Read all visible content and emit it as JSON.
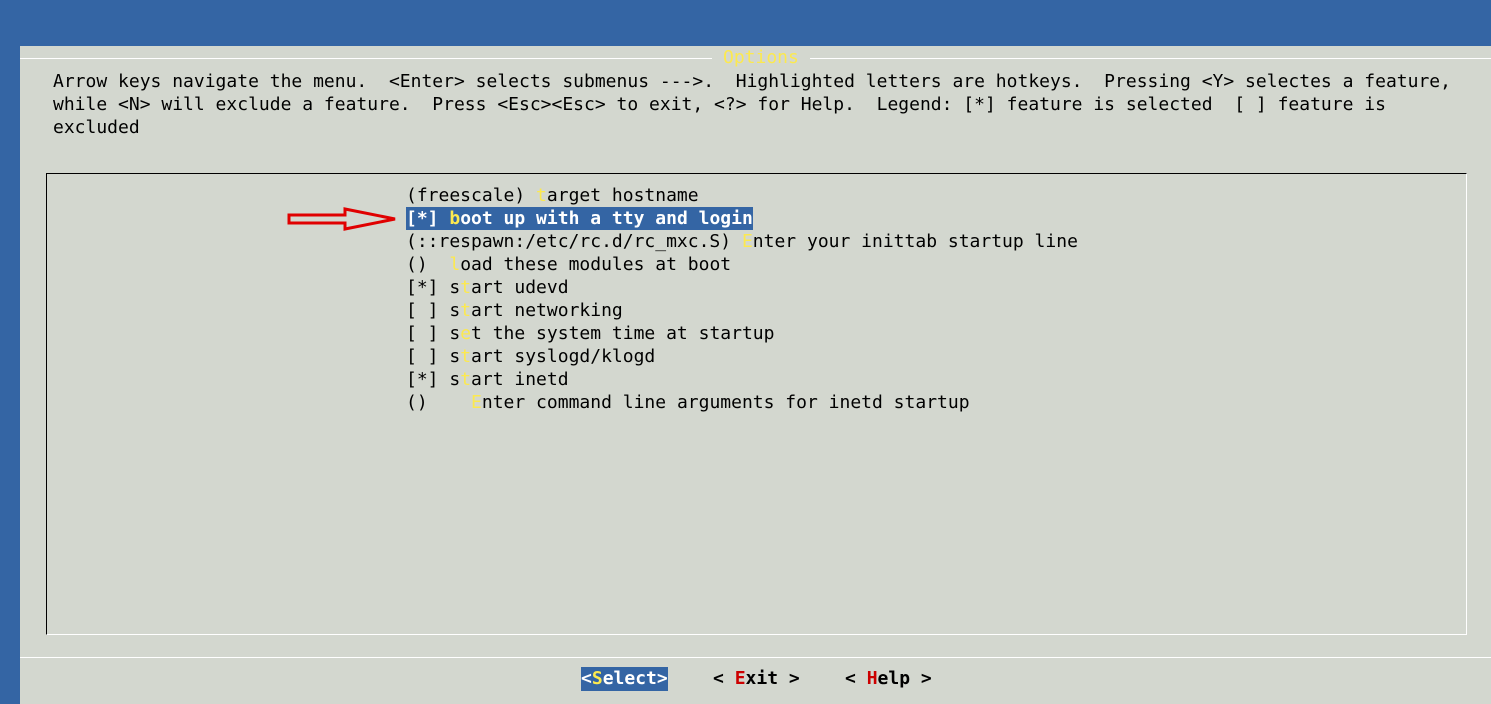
{
  "dialog": {
    "title": "Options",
    "help_lines": [
      "Arrow keys navigate the menu.  <Enter> selects submenus --->.  Highlighted letters are hotkeys.  Pressing <Y> selectes a feature,",
      "while <N> will exclude a feature.  Press <Esc><Esc> to exit, <?> for Help.  Legend: [*] feature is selected  [ ] feature is",
      "excluded"
    ]
  },
  "menu": {
    "items": [
      {
        "prefix": "(freescale) ",
        "hotkey": "t",
        "rest": "arget hostname"
      },
      {
        "prefix": "[*] ",
        "hotkey": "b",
        "rest": "oot up with a tty and login"
      },
      {
        "prefix": "(::respawn:/etc/rc.d/rc_mxc.S) ",
        "hotkey": "E",
        "rest": "nter your inittab startup line"
      },
      {
        "prefix": "()  ",
        "hotkey": "l",
        "rest": "oad these modules at boot"
      },
      {
        "prefix": "[*] s",
        "hotkey": "t",
        "rest": "art udevd"
      },
      {
        "prefix": "[ ] s",
        "hotkey": "t",
        "rest": "art networking"
      },
      {
        "prefix": "[ ] s",
        "hotkey": "e",
        "rest": "t the system time at startup"
      },
      {
        "prefix": "[ ] s",
        "hotkey": "t",
        "rest": "art syslogd/klogd"
      },
      {
        "prefix": "[*] s",
        "hotkey": "t",
        "rest": "art inetd"
      },
      {
        "prefix": "()    ",
        "hotkey": "E",
        "rest": "nter command line arguments for inetd startup"
      }
    ]
  },
  "buttons": {
    "select": {
      "open": "<",
      "hotkey": "S",
      "rest": "elect>"
    },
    "exit": {
      "open": "< ",
      "hotkey": "E",
      "rest": "xit >"
    },
    "help": {
      "open": "< ",
      "hotkey": "H",
      "rest": "elp >"
    }
  },
  "colors": {
    "background": "#3465a4",
    "dialog": "#d3d7cf",
    "hotkey": "#fce94f",
    "button_hotkey": "#cc0000",
    "selection": "#3465a4",
    "annotation_arrow": "#e00000"
  },
  "icons": {
    "annotation": "red-arrow-icon"
  }
}
